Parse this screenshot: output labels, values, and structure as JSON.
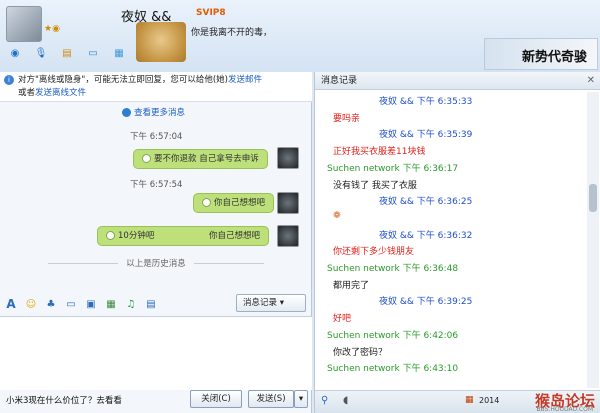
{
  "contact": {
    "nickname": "夜奴 &&",
    "vip_badge": "SVIP8",
    "status_message": "你是我离不开的毒，"
  },
  "banner": {
    "text": "新势代奇骏"
  },
  "toolbar": {
    "icons": [
      "video-call",
      "voice-call",
      "file-transfer",
      "remote-desktop",
      "app-grid"
    ]
  },
  "notice": {
    "text_prefix": "对方\"离线或隐身\"，可能无法立即回复，您可以给他(她)",
    "link_mail": "发送邮件",
    "text_mid": "或者",
    "link_file": "发送离线文件"
  },
  "history": {
    "more_link": "查看更多消息",
    "divider": "以上是历史消息",
    "messages": [
      {
        "time": "下午 6:57:04",
        "text": "要不你退款 自己拿号去申诉"
      },
      {
        "time": "下午 6:57:54",
        "text": "你自己想想吧"
      },
      {
        "time": "",
        "text": "10分钟吧",
        "text2": "你自己想想吧"
      }
    ]
  },
  "editor": {
    "history_button": "消息记录",
    "input_text": "小米3现在什么价位了？去看看",
    "close_button": "关闭(C)",
    "send_button": "发送(S)"
  },
  "record_panel": {
    "title": "消息记录",
    "date": "2014",
    "lines": [
      {
        "kind": "head",
        "text": "夜奴   &&   下午 6:35:33"
      },
      {
        "kind": "red",
        "text": "要吗亲"
      },
      {
        "kind": "head",
        "text": "夜奴   &&   下午 6:35:39"
      },
      {
        "kind": "red",
        "text": "正好我买衣服差11块钱"
      },
      {
        "kind": "green",
        "text": "Suchen network 下午 6:36:17"
      },
      {
        "kind": "black",
        "text": "没有钱了  我买了衣服"
      },
      {
        "kind": "head",
        "text": "夜奴   &&   下午 6:36:25"
      },
      {
        "kind": "red",
        "text": ""
      },
      {
        "kind": "head",
        "text": "夜奴   &&   下午 6:36:32"
      },
      {
        "kind": "red",
        "text": "你还剩下多少钱朋友"
      },
      {
        "kind": "green",
        "text": "Suchen network 下午 6:36:48"
      },
      {
        "kind": "black",
        "text": "都用完了"
      },
      {
        "kind": "head",
        "text": "夜奴   &&   下午 6:39:25"
      },
      {
        "kind": "red",
        "text": "好吧"
      },
      {
        "kind": "green",
        "text": "Suchen network 下午 6:42:06"
      },
      {
        "kind": "black",
        "text": "你改了密码？"
      },
      {
        "kind": "green",
        "text": "Suchen network 下午 6:43:10"
      }
    ]
  },
  "watermark": {
    "text": "猴岛论坛",
    "sub": "BBS.HOUDAO.COM"
  },
  "colors": {
    "head": "#1f4fd1",
    "red": "#e0201a",
    "green": "#2b9a2b",
    "bubble": "#bde07a"
  }
}
